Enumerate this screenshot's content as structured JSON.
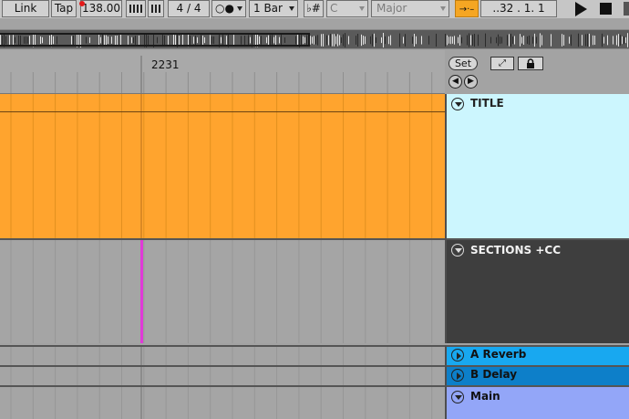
{
  "control_bar": {
    "link_label": "Link",
    "tap_label": "Tap",
    "tempo": "138.00",
    "time_signature": "4 / 4",
    "metronome": "○●",
    "quantization": "1 Bar",
    "key_icon": "♭#",
    "key": "C",
    "scale": "Major",
    "follow_icon": "→·–",
    "position": "..32 .  1.  1"
  },
  "arrangement": {
    "ruler_label": "2231",
    "set_label": "Set",
    "draw_icon": "⤢",
    "lock_icon": "🔒",
    "prev_icon": "◀",
    "next_icon": "▶"
  },
  "tracks": [
    {
      "name": "TITLE",
      "color": "#ccf6fe",
      "clip_color": "#ffa42e",
      "folded": false
    },
    {
      "name": "SECTIONS +CC",
      "color": "#3e3e3e",
      "folded": false
    },
    {
      "name": "A Reverb",
      "color": "#18a8f0",
      "folded": true
    },
    {
      "name": "B Delay",
      "color": "#0d7fc9",
      "folded": true
    },
    {
      "name": "Main",
      "color": "#93a6f8",
      "folded": false
    }
  ],
  "colors": {
    "clip": "#ffa42e",
    "playhead_marker": "#e03ad8",
    "follow_active": "#f5a623"
  }
}
